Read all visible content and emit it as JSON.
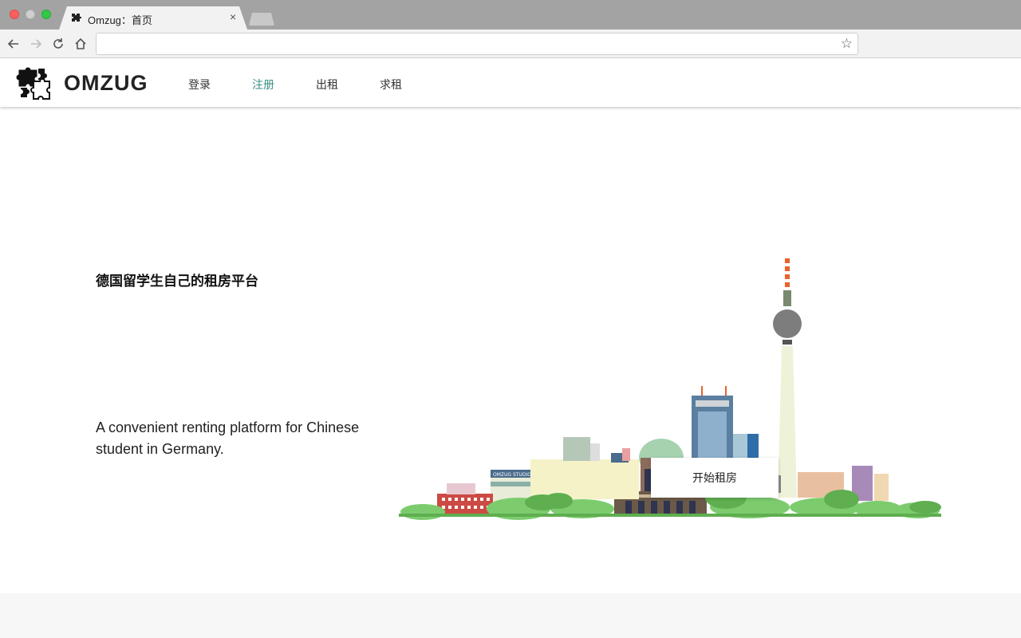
{
  "browser": {
    "tab_title": "Omzug：首页",
    "tab_close": "×",
    "url": ""
  },
  "header": {
    "logo_text": "OMZUG",
    "nav": [
      {
        "label": "登录",
        "active": false
      },
      {
        "label": "注册",
        "active": true
      },
      {
        "label": "出租",
        "active": false
      },
      {
        "label": "求租",
        "active": false
      }
    ]
  },
  "hero": {
    "title_cn": "德国留学生自己的租房平台",
    "subtitle_en": "A convenient renting platform for Chinese student in Germany.",
    "cta_label": "开始租房",
    "illustration_sign": "OMZUG STUDIO"
  },
  "colors": {
    "accent": "#3a8f86",
    "text": "#222222"
  }
}
